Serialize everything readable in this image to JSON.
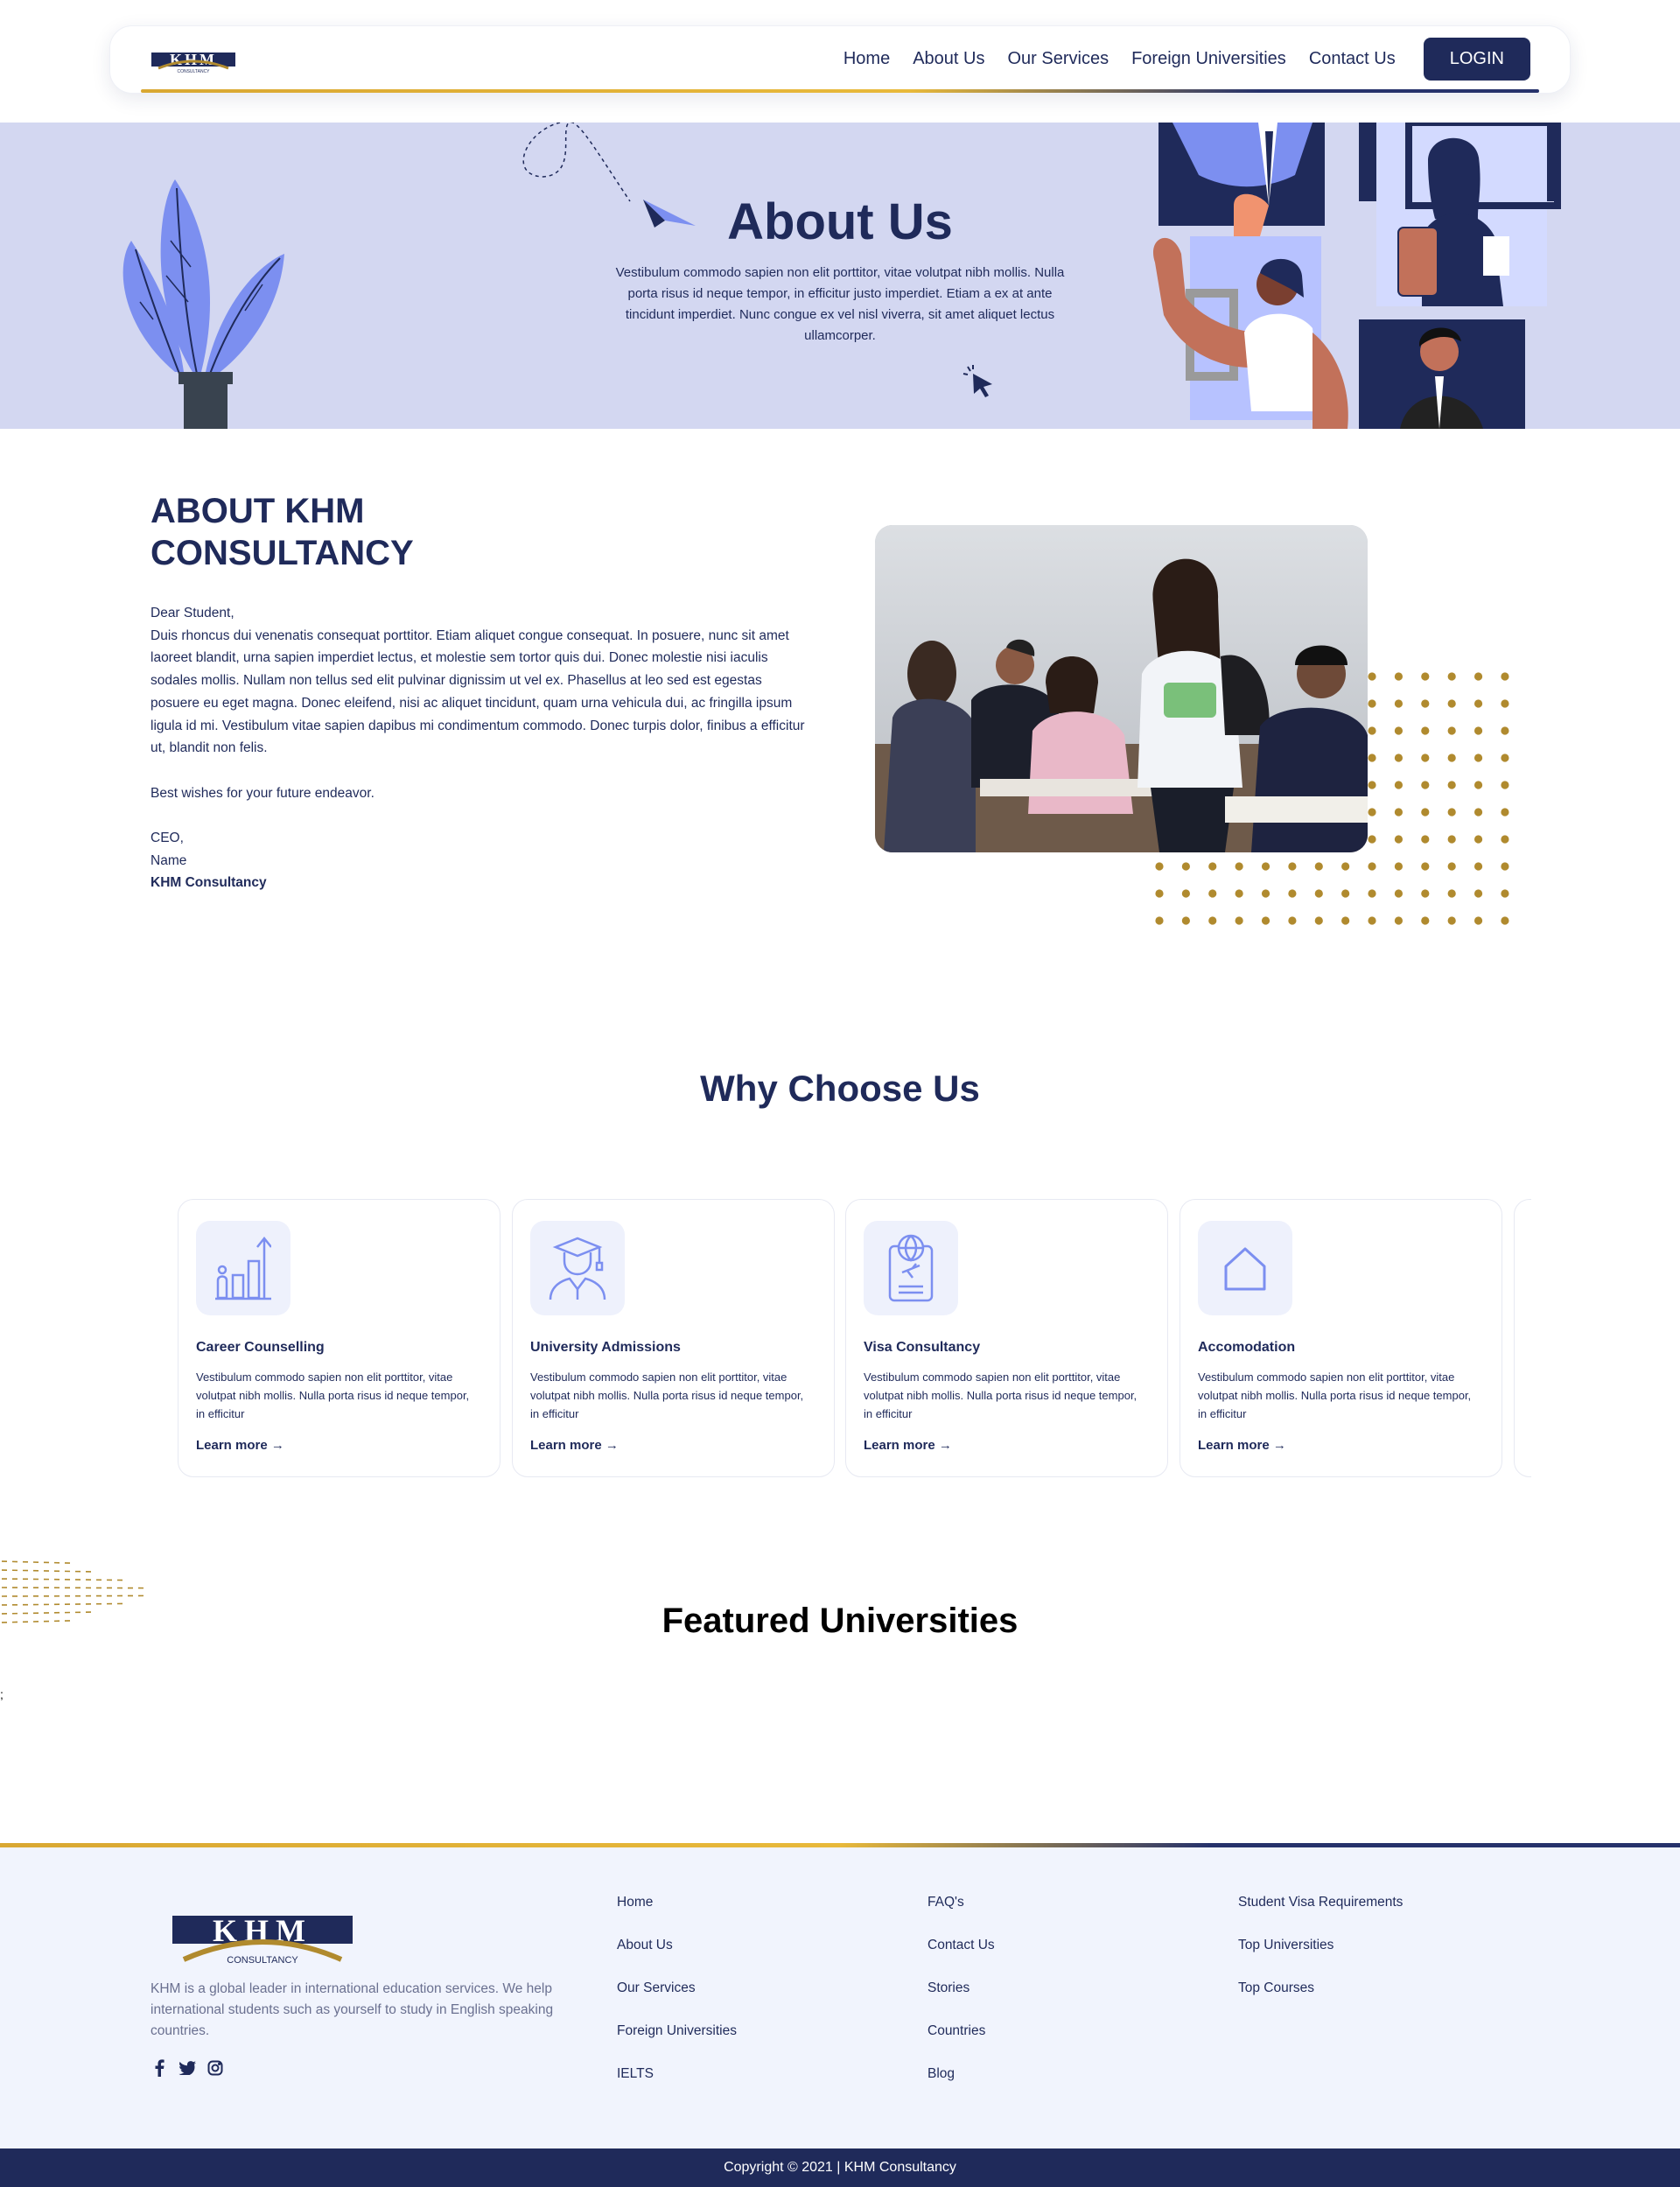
{
  "nav": {
    "brand": "KHM",
    "brand_sub": "CONSULTANCY",
    "links": [
      "Home",
      "About Us",
      "Our Services",
      "Foreign Universities",
      "Contact Us"
    ],
    "login_label": "LOGIN"
  },
  "hero": {
    "title": "About Us",
    "text": "Vestibulum commodo sapien non elit porttitor, vitae volutpat nibh mollis. Nulla porta risus id neque tempor, in efficitur justo imperdiet. Etiam a ex at ante tincidunt imperdiet. Nunc congue ex vel nisl viverra, sit amet aliquet lectus ullamcorper."
  },
  "about": {
    "title": "ABOUT KHM CONSULTANCY",
    "greeting": "Dear Student,",
    "body": "Duis rhoncus dui venenatis consequat porttitor. Etiam aliquet congue consequat. In posuere, nunc sit amet laoreet blandit, urna sapien imperdiet lectus, et molestie sem tortor quis dui. Donec molestie nisi iaculis sodales mollis. Nullam non tellus sed elit pulvinar dignissim ut vel ex. Phasellus at leo sed est egestas posuere eu eget magna. Donec eleifend, nisi ac aliquet tincidunt, quam urna vehicula dui, ac fringilla ipsum ligula id mi. Vestibulum vitae sapien dapibus mi condimentum commodo. Donec turpis dolor, finibus a efficitur ut, blandit non felis.",
    "wishes": "Best wishes for your future endeavor.",
    "sign_role": "CEO,",
    "sign_name": "Name",
    "sign_company": "KHM Consultancy"
  },
  "why": {
    "title": "Why Choose Us",
    "cards": [
      {
        "icon": "growth-chart-icon",
        "title": "Career Counselling",
        "text": "Vestibulum commodo sapien non elit porttitor, vitae volutpat nibh mollis. Nulla porta risus id neque tempor, in efficitur",
        "link": "Learn more"
      },
      {
        "icon": "graduate-icon",
        "title": "University Admissions",
        "text": "Vestibulum commodo sapien non elit porttitor, vitae volutpat nibh mollis. Nulla porta risus id neque tempor, in efficitur",
        "link": "Learn more"
      },
      {
        "icon": "passport-icon",
        "title": "Visa Consultancy",
        "text": "Vestibulum commodo sapien non elit porttitor, vitae volutpat nibh mollis. Nulla porta risus id neque tempor, in efficitur",
        "link": "Learn more"
      },
      {
        "icon": "house-icon",
        "title": "Accomodation",
        "text": "Vestibulum commodo sapien non elit porttitor, vitae volutpat nibh mollis. Nulla porta risus id neque tempor, in efficitur",
        "link": "Learn more"
      }
    ]
  },
  "featured": {
    "title": "Featured Universities",
    "stray": ";"
  },
  "footer": {
    "about": "KHM is a global leader in international education services. We help international students such as yourself to study in English speaking countries.",
    "socials": [
      "facebook-icon",
      "twitter-icon",
      "instagram-icon"
    ],
    "col1": [
      "Home",
      "About Us",
      "Our Services",
      "Foreign Universities",
      "IELTS"
    ],
    "col2": [
      "FAQ's",
      "Contact Us",
      "Stories",
      "Countries",
      "Blog"
    ],
    "col3": [
      "Student Visa Requirements",
      "Top Universities",
      "Top Courses"
    ],
    "copyright": "Copyright © 2021 | KHM Consultancy"
  },
  "colors": {
    "navy": "#1f2a5a",
    "gold": "#b08a2e",
    "hero_bg": "#d3d7f1",
    "accent_blue": "#7c8ff0",
    "footer_bg": "#f1f4fd"
  }
}
